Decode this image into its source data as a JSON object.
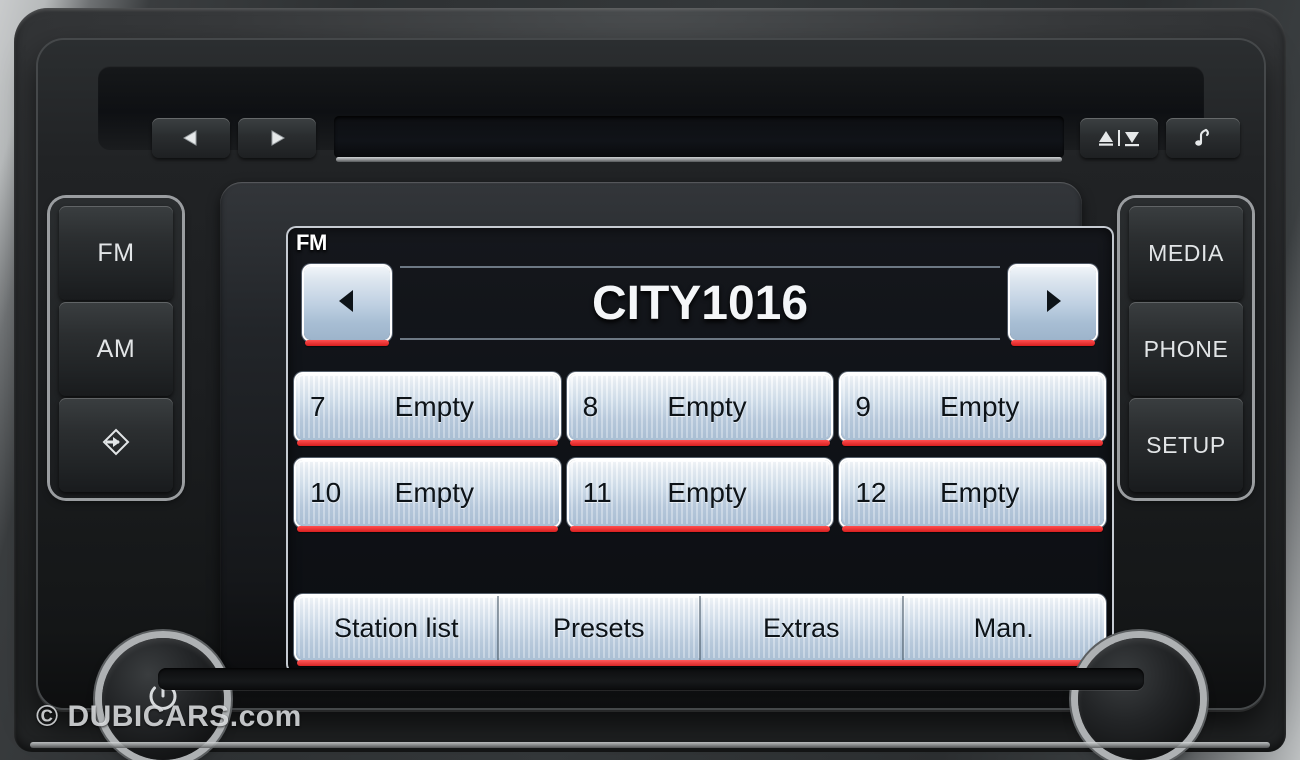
{
  "device": {
    "name": "VW RCD 310 car radio head unit",
    "watermark": "© DUBICARS.com"
  },
  "top_controls": [
    {
      "name": "previous-track-button",
      "icon": "triangle-left-icon",
      "label": ""
    },
    {
      "name": "next-track-button",
      "icon": "triangle-right-icon",
      "label": ""
    },
    {
      "name": "eject-load-button",
      "icon": "eject-load-icon",
      "label": ""
    },
    {
      "name": "audio-note-button",
      "icon": "music-note-icon",
      "label": ""
    }
  ],
  "left_keys": [
    {
      "label": "FM",
      "name": "fm-button",
      "icon": ""
    },
    {
      "label": "AM",
      "name": "am-button",
      "icon": ""
    },
    {
      "label": "",
      "name": "traffic-program-button",
      "icon": "diamond-arrow-icon"
    }
  ],
  "right_keys": [
    {
      "label": "MEDIA",
      "name": "media-button"
    },
    {
      "label": "PHONE",
      "name": "phone-button"
    },
    {
      "label": "SETUP",
      "name": "setup-button"
    }
  ],
  "knobs": {
    "left": {
      "name": "power-volume-knob",
      "icon": "power-icon"
    },
    "right": {
      "name": "tuning-knob",
      "icon": ""
    }
  },
  "screen": {
    "band_badge": "FM",
    "station_name": "CITY1016",
    "prev_station_icon": "triangle-left-icon",
    "next_station_icon": "triangle-right-icon",
    "presets": [
      {
        "number": "7",
        "label": "Empty"
      },
      {
        "number": "8",
        "label": "Empty"
      },
      {
        "number": "9",
        "label": "Empty"
      },
      {
        "number": "10",
        "label": "Empty"
      },
      {
        "number": "11",
        "label": "Empty"
      },
      {
        "number": "12",
        "label": "Empty"
      }
    ],
    "tabs": [
      {
        "label": "Station list"
      },
      {
        "label": "Presets"
      },
      {
        "label": "Extras"
      },
      {
        "label": "Man."
      }
    ]
  },
  "colors": {
    "accent_red": "#d81f1f",
    "button_face": "#cfdded",
    "lcd_background": "#101318",
    "text_light": "#f4f6f8",
    "text_dark": "#0d1318"
  }
}
